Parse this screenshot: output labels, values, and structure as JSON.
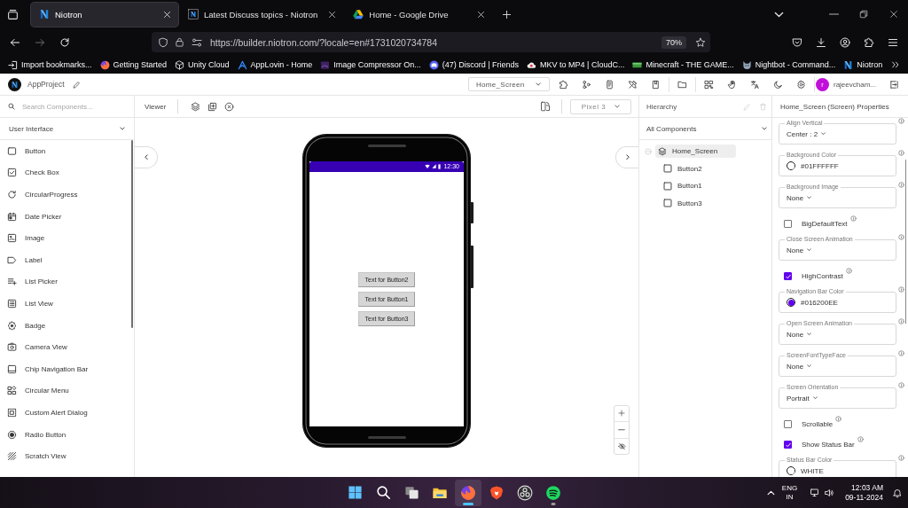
{
  "browser": {
    "tabs": [
      {
        "title": "Niotron",
        "selected": true
      },
      {
        "title": "Latest Discuss topics - Niotron",
        "selected": false
      },
      {
        "title": "Home - Google Drive",
        "selected": false
      }
    ],
    "url": "https://builder.niotron.com/?locale=en#1731020734784",
    "zoom": "70%",
    "bookmarks": [
      "Import bookmarks...",
      "Getting Started",
      "Unity Cloud",
      "AppLovin - Home",
      "Image Compressor On...",
      "(47) Discord | Friends",
      "MKV to MP4 | CloudC...",
      "Minecraft - THE GAME...",
      "Nightbot - Command...",
      "Niotron"
    ]
  },
  "app_header": {
    "project": "AppProject",
    "screen": "Home_Screen",
    "user_initial": "r",
    "user_name": "rajeevcham..."
  },
  "palette": {
    "search_placeholder": "Search Components...",
    "category": "User Interface",
    "components": [
      "Button",
      "Check Box",
      "CircularProgress",
      "Date Picker",
      "Image",
      "Label",
      "List Picker",
      "List View",
      "Badge",
      "Camera View",
      "Chip Navigation Bar",
      "Circular Menu",
      "Custom Alert Dialog",
      "Radio Button",
      "Scratch View"
    ]
  },
  "viewer": {
    "title": "Viewer",
    "device": "Pixel 3",
    "status_time": "12:30",
    "buttons": [
      "Text for Button2",
      "Text for Button1",
      "Text for Button3"
    ]
  },
  "hierarchy": {
    "title": "Hierarchy",
    "tools_disabled": true,
    "filter": "All Components",
    "tree": [
      {
        "label": "Home_Screen",
        "selected": true,
        "expanded": true,
        "children": [
          {
            "label": "Button2",
            "selected": false
          },
          {
            "label": "Button1",
            "selected": false
          },
          {
            "label": "Button3",
            "selected": false
          }
        ]
      }
    ]
  },
  "properties": {
    "title": "Home_Screen (Screen) Properties",
    "items": [
      {
        "kind": "select",
        "label": "Align Vertical",
        "value": "Center : 2"
      },
      {
        "kind": "color",
        "label": "Background Color",
        "value": "#01FFFFFF",
        "color": "#ffffff"
      },
      {
        "kind": "select",
        "label": "Background Image",
        "value": "None"
      },
      {
        "kind": "checkbox",
        "label": "BigDefaultText",
        "checked": false
      },
      {
        "kind": "select",
        "label": "Close Screen Animation",
        "value": "None"
      },
      {
        "kind": "checkbox",
        "label": "HighContrast",
        "checked": true
      },
      {
        "kind": "color",
        "label": "Navigation Bar Color",
        "value": "#016200EE",
        "color": "#6200ee"
      },
      {
        "kind": "select",
        "label": "Open Screen Animation",
        "value": "None"
      },
      {
        "kind": "select",
        "label": "ScreenFontTypeFace",
        "value": "None"
      },
      {
        "kind": "select",
        "label": "Screen Orientation",
        "value": "Portrait"
      },
      {
        "kind": "checkbox",
        "label": "Scrollable",
        "checked": false
      },
      {
        "kind": "checkbox",
        "label": "Show Status Bar",
        "checked": true
      },
      {
        "kind": "color",
        "label": "Status Bar Color",
        "value": "WHITE",
        "color": "#ffffff"
      }
    ]
  },
  "taskbar": {
    "apps": [
      {
        "running": false,
        "active": false
      },
      {
        "running": true,
        "active": true
      },
      {
        "running": false,
        "active": false
      },
      {
        "running": false,
        "active": false
      },
      {
        "running": true,
        "active": false
      }
    ],
    "language": "ENG",
    "region": "IN",
    "time": "12:03 AM",
    "date": "09-11-2024"
  }
}
